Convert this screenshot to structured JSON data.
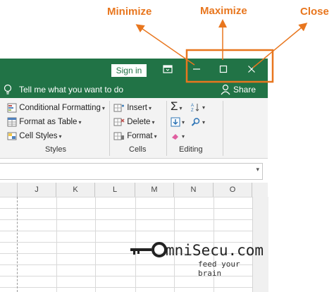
{
  "annotations": {
    "minimize": "Minimize",
    "maximize": "Maximize",
    "close": "Close",
    "color": "#e8761e"
  },
  "titlebar": {
    "sign_in": "Sign in",
    "ribbon_options_icon": "ribbon-display-options-icon",
    "minimize_icon": "minimize-icon",
    "maximize_icon": "maximize-icon",
    "close_icon": "close-icon",
    "color": "#217346"
  },
  "tell_bar": {
    "text": "Tell me what you want to do",
    "share": "Share"
  },
  "ribbon": {
    "styles": {
      "conditional_formatting": "Conditional Formatting",
      "format_as_table": "Format as Table",
      "cell_styles": "Cell Styles",
      "label": "Styles"
    },
    "cells": {
      "insert": "Insert",
      "delete": "Delete",
      "format": "Format",
      "label": "Cells"
    },
    "editing": {
      "label": "Editing"
    }
  },
  "grid": {
    "columns": [
      "J",
      "K",
      "L",
      "M",
      "N",
      "O"
    ]
  },
  "logo": {
    "text": "mniSecu.com",
    "tagline": "feed your brain"
  }
}
